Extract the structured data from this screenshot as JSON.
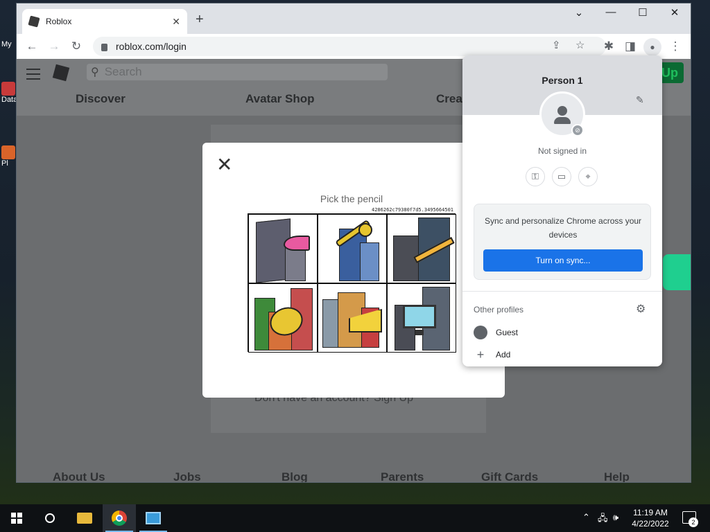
{
  "desktop": {
    "icons": [
      {
        "label": "My"
      },
      {
        "label": "Data"
      },
      {
        "label": "Pl"
      }
    ]
  },
  "browser": {
    "tab": {
      "title": "Roblox",
      "close_label": "✕"
    },
    "new_tab_label": "+",
    "window_controls": {
      "tab_search": "⌄",
      "minimize": "—",
      "maximize": "☐",
      "close": "✕"
    },
    "nav": {
      "back": "←",
      "forward": "→",
      "reload": "↻"
    },
    "url": "roblox.com/login",
    "toolbar_icons": {
      "share": "⇪",
      "bookmark": "☆",
      "extensions": "✱",
      "side_panel": "◨",
      "menu": "⋮"
    }
  },
  "site": {
    "search_placeholder": "Search",
    "nav_links": [
      "Discover",
      "Avatar Shop",
      "Crea"
    ],
    "signup_label": "Up",
    "behind_text": "Don't have an account? Sign Up",
    "footer_links": [
      "About Us",
      "Jobs",
      "Blog",
      "Parents",
      "Gift Cards",
      "Help"
    ]
  },
  "captcha": {
    "close_label": "✕",
    "prompt": "Pick the pencil",
    "challenge_id": "4286262c79380f7d5.3495664501",
    "tiles": [
      {
        "name": "tile-shoe",
        "object": "high-heel shoe"
      },
      {
        "name": "tile-key",
        "object": "key"
      },
      {
        "name": "tile-pencil",
        "object": "pencil"
      },
      {
        "name": "tile-coins",
        "object": "coins"
      },
      {
        "name": "tile-cheese",
        "object": "cheese"
      },
      {
        "name": "tile-monitor",
        "object": "monitor"
      }
    ]
  },
  "profile_menu": {
    "name": "Person 1",
    "status": "Not signed in",
    "sync_text": "Sync and personalize Chrome across your devices",
    "sync_button": "Turn on sync...",
    "other_profiles_label": "Other profiles",
    "guest_label": "Guest",
    "add_label": "Add"
  },
  "taskbar": {
    "time": "11:19 AM",
    "date": "4/22/2022",
    "notification_count": "2"
  },
  "colors": {
    "sync_button": "#1a73e8",
    "roblox_green": "#0b6a33"
  }
}
